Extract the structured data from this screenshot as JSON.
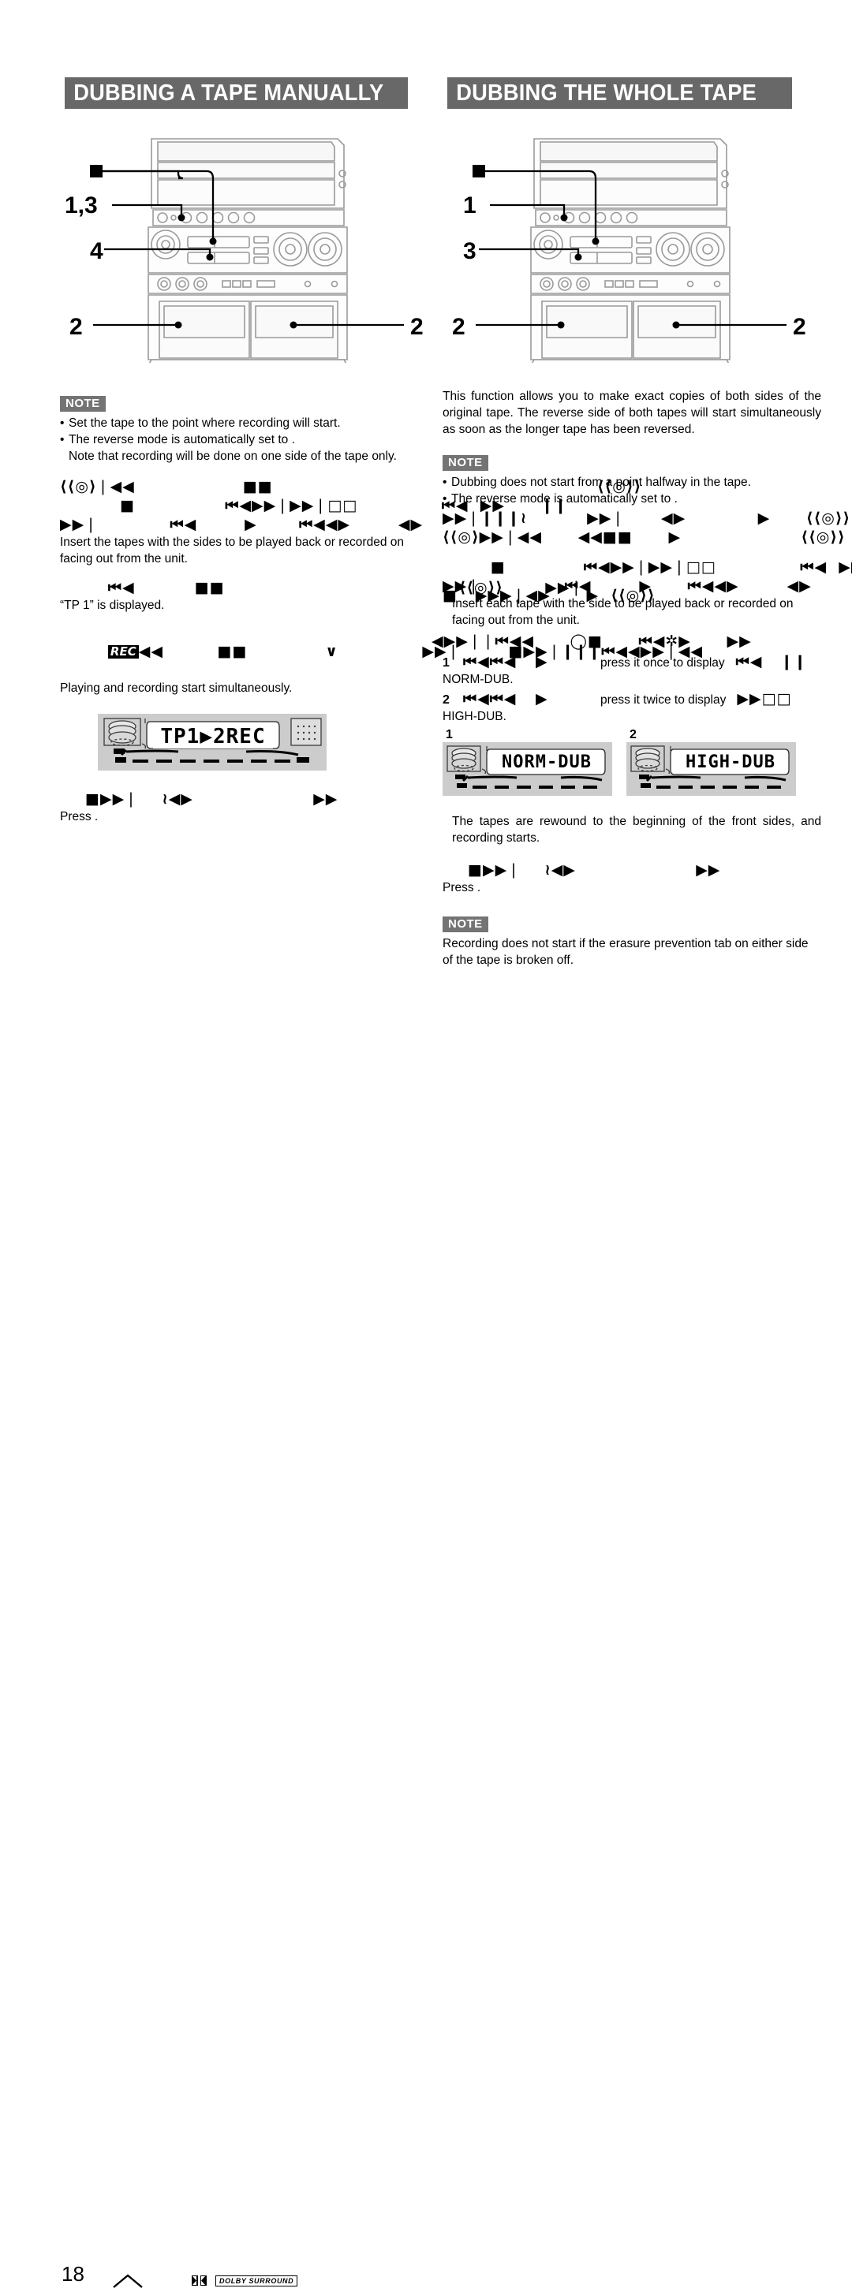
{
  "document": {
    "page_number": "18",
    "footer_logo_mark": "□□",
    "footer_logo_text": "DOLBY SURROUND",
    "caret_icon": "caret-up-icon"
  },
  "sections": [
    {
      "id": "dubbing-a-tape-manually",
      "title": "DUBBING A TAPE MANUALLY",
      "diagram": {
        "name": "stereo-system-front-panel",
        "callouts": [
          {
            "label": "■",
            "kind": "square"
          },
          {
            "label": "1,3"
          },
          {
            "label": "4"
          },
          {
            "label": "2",
            "side": "left"
          },
          {
            "label": "2",
            "side": "right"
          }
        ]
      },
      "note": {
        "badge": "NOTE",
        "items": [
          "Set the tape to the point where recording will start.",
          "The reverse mode is automatically set to        ."
        ],
        "sub": "Note that recording will be done on one side of the tape only."
      },
      "steps": [
        {
          "symbols_top": "⟨⟨◎⟩❘◀◀                  ■■                                                      ⟨⟨◎⟩⟩",
          "symbols_mid": "          ■               ⏮◀▶▶❘▶▶❘□□              ⏮◀  ▶▶      ❙❙",
          "symbols_bot": "▶▶❘            ⏮◀        ▶       ⏮◀◀▶        ◀▶",
          "text": "Insert the tapes with the sides to be played back or recorded on facing out from the unit."
        },
        {
          "symbols_top": "        ⏮◀          ■■                                       ⟨⟨◎⟩⟩       ▶▶❘",
          "text": "“TP 1” is displayed."
        },
        {
          "rec_badge": "REC",
          "symbols_top": "◀◀         ■■             ∨              ▶▶❘        ■▶▶❘❙❙❙⏮◀◀▶▶❘◀◀",
          "text": "Playing and recording start simultaneously."
        }
      ],
      "lcd": {
        "name": "lcd-display-tp1-2rec",
        "text": "TP1▶2REC"
      },
      "final": {
        "symbols": "■▶▶❘    ≀◀▶                    ▶▶",
        "text": "Press        ."
      }
    },
    {
      "id": "dubbing-the-whole-tape",
      "title": "DUBBING THE WHOLE TAPE",
      "diagram": {
        "name": "stereo-system-front-panel",
        "callouts": [
          {
            "label": "■",
            "kind": "square"
          },
          {
            "label": "1"
          },
          {
            "label": "3"
          },
          {
            "label": "2",
            "side": "left"
          },
          {
            "label": "2",
            "side": "right"
          }
        ]
      },
      "intro": "This function allows you to make exact copies of both sides of the original tape. The reverse side of both tapes will start simultaneously as soon as the longer tape has been reversed.",
      "note": {
        "badge": "NOTE",
        "items": [
          "Dubbing does not start from a point halfway in the tape.",
          "The reverse mode is automatically set to        ."
        ]
      },
      "steps": [
        {
          "symbols_top": "▶▶❘❙❙❙≀          ▶▶❘      ◀▶            ▶      ⟨⟨◎⟩⟩❙❙  ◀▶▶▶❘",
          "symbols_bot": "⟨⟨◎⟩▶▶❘◀◀      ◀◀■■      ▶                    ⟨⟨◎⟩⟩"
        },
        {
          "symbols_top": "        ■             ⏮◀▶▶❘▶▶❘□□              ⏮◀  ▶▶     ❙❙   ▶▶",
          "symbols_mid": "▶▶❘              ⏮◀        ▶      ⏮◀◀▶        ◀▶",
          "symbols_overlay": "■   ▶▶▶❘◀▶      ▶  ⟨⟨◎⟩⟩",
          "text": "Insert each tape with the side to be played back or recorded on facing out from the unit."
        },
        {
          "symbols_top": "◀▶▶❘❘⏮◀◀      ◯■      ⏮◀✲▶      ▶▶                    ▶"
        }
      ],
      "numbered": [
        {
          "num": "1",
          "symbols_a": "⏮◀⏮◀",
          "symbols_b": "▶",
          "text": "press it once to display",
          "symbols_c": "⏮◀   ❙❙",
          "tail": "NORM-DUB."
        },
        {
          "num": "2",
          "symbols_a": "⏮◀⏮◀",
          "symbols_b": "▶",
          "text": "press it twice to display",
          "symbols_c": "▶▶□□",
          "tail": "HIGH-DUB."
        }
      ],
      "lcds": [
        {
          "num": "1",
          "name": "lcd-display-norm-dub",
          "text": "NORM-DUB"
        },
        {
          "num": "2",
          "name": "lcd-display-high-dub",
          "text": "HIGH-DUB"
        }
      ],
      "after_lcd": "The tapes are rewound to the beginning of the front sides, and recording starts.",
      "final": {
        "symbols": "■▶▶❘    ≀◀▶                    ▶▶",
        "text": "Press        ."
      },
      "note2": {
        "badge": "NOTE",
        "text": "Recording does not start if the erasure prevention tab on either side of the tape is broken off."
      }
    }
  ]
}
